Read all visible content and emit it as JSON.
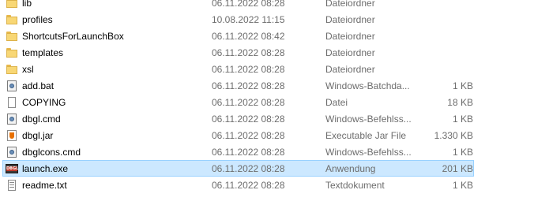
{
  "files": [
    {
      "name": "lib",
      "date": "06.11.2022 08:28",
      "type": "Dateiordner",
      "size": "",
      "icon": "folder-icon"
    },
    {
      "name": "profiles",
      "date": "10.08.2022 11:15",
      "type": "Dateiordner",
      "size": "",
      "icon": "folder-icon"
    },
    {
      "name": "ShortcutsForLaunchBox",
      "date": "06.11.2022 08:42",
      "type": "Dateiordner",
      "size": "",
      "icon": "folder-icon"
    },
    {
      "name": "templates",
      "date": "06.11.2022 08:28",
      "type": "Dateiordner",
      "size": "",
      "icon": "folder-icon"
    },
    {
      "name": "xsl",
      "date": "06.11.2022 08:28",
      "type": "Dateiordner",
      "size": "",
      "icon": "folder-icon"
    },
    {
      "name": "add.bat",
      "date": "06.11.2022 08:28",
      "type": "Windows-Batchda...",
      "size": "1 KB",
      "icon": "batch-file-icon"
    },
    {
      "name": "COPYING",
      "date": "06.11.2022 08:28",
      "type": "Datei",
      "size": "18 KB",
      "icon": "file-icon"
    },
    {
      "name": "dbgl.cmd",
      "date": "06.11.2022 08:28",
      "type": "Windows-Befehlss...",
      "size": "1 KB",
      "icon": "cmd-file-icon"
    },
    {
      "name": "dbgl.jar",
      "date": "06.11.2022 08:28",
      "type": "Executable Jar File",
      "size": "1.330 KB",
      "icon": "jar-file-icon"
    },
    {
      "name": "dbglcons.cmd",
      "date": "06.11.2022 08:28",
      "type": "Windows-Befehlss...",
      "size": "1 KB",
      "icon": "cmd-file-icon"
    },
    {
      "name": "launch.exe",
      "date": "06.11.2022 08:28",
      "type": "Anwendung",
      "size": "201 KB",
      "icon": "dbgl-exe-icon",
      "selected": true
    },
    {
      "name": "readme.txt",
      "date": "06.11.2022 08:28",
      "type": "Textdokument",
      "size": "1 KB",
      "icon": "text-file-icon"
    }
  ]
}
